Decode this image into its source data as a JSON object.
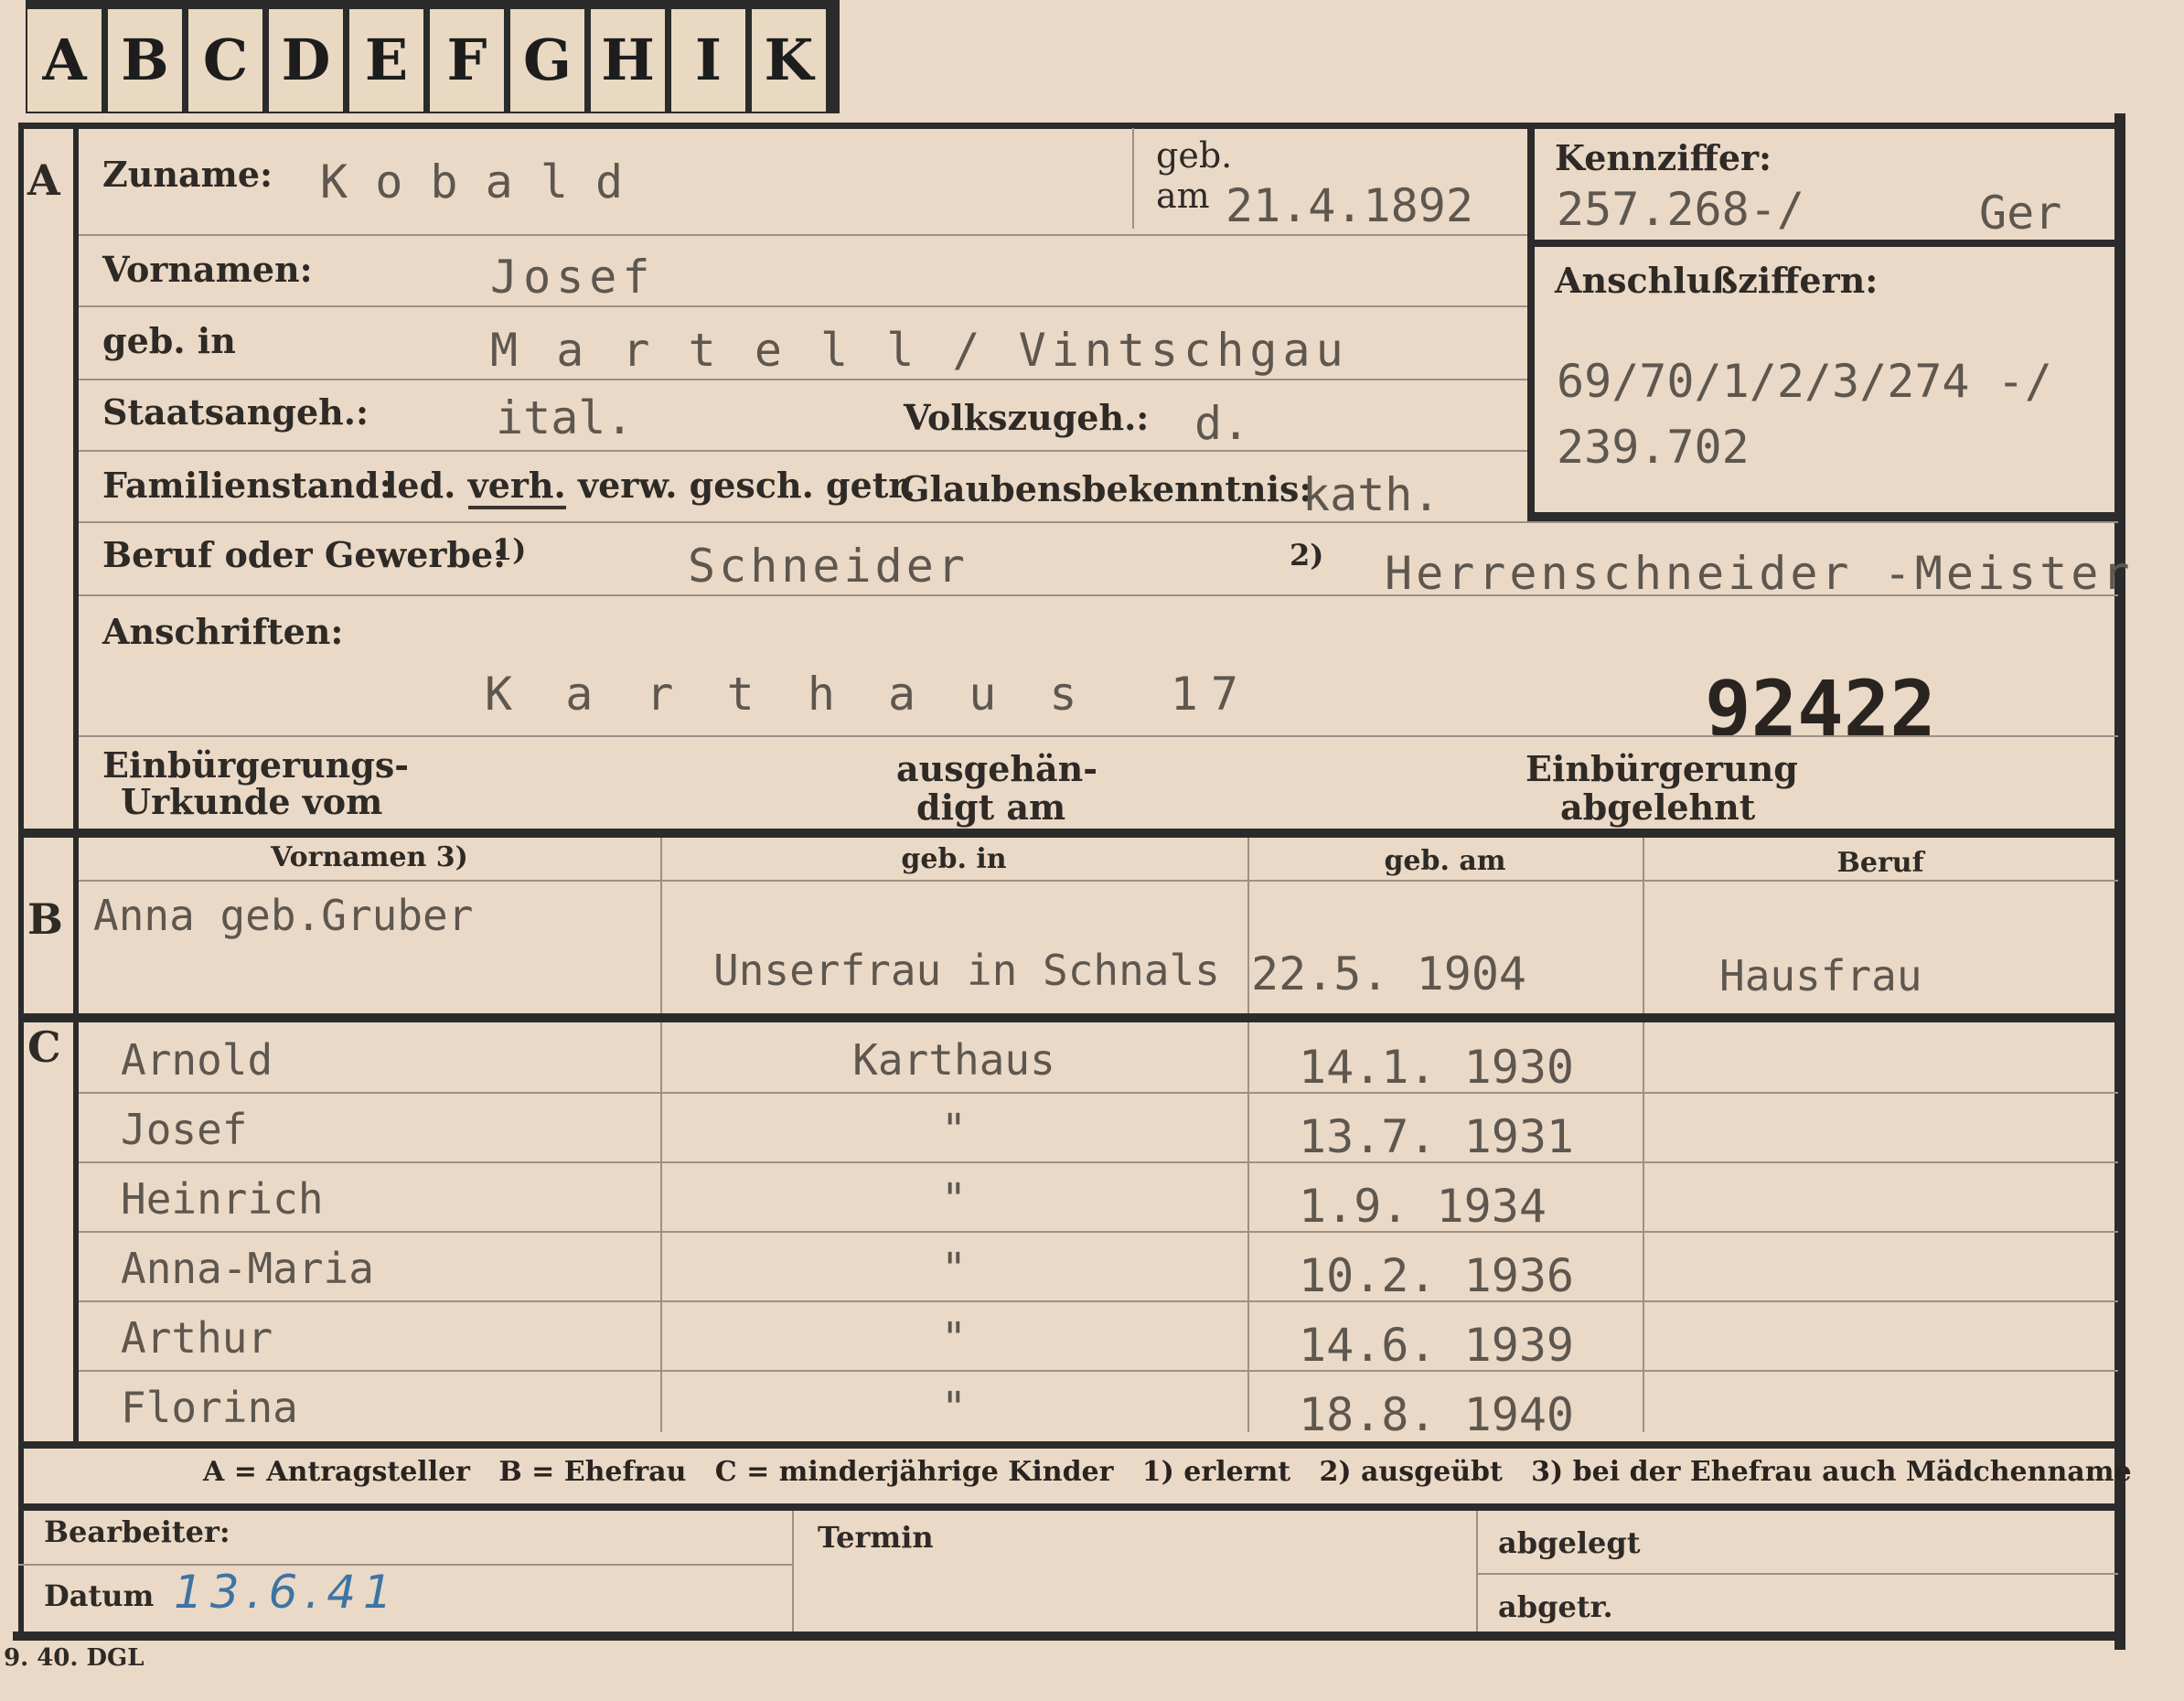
{
  "tabs": [
    "A",
    "B",
    "C",
    "D",
    "E",
    "F",
    "G",
    "H",
    "I",
    "K"
  ],
  "sections": {
    "a": "A",
    "b": "B",
    "c": "C"
  },
  "applicant": {
    "surname_label": "Zuname:",
    "surname": "K o b a l d",
    "born_label": "geb.",
    "born_on_label": "am",
    "born_date": "21.4.1892",
    "id_label": "Kennziffer:",
    "id_number": "257.268-/",
    "id_suffix": "Ger",
    "connect_label": "Anschlußziffern:",
    "connect_line1": "69/70/1/2/3/274 -/",
    "connect_line2": "239.702",
    "firstname_label": "Vornamen:",
    "firstname": "Josef",
    "birthplace_label": "geb. in",
    "birthplace": "M a r t e l l / Vintschgau",
    "citizenship_label": "Staatsangeh.:",
    "citizenship": "ital.",
    "nationality_label": "Volkszugeh.:",
    "nationality": "d.",
    "marital_label": "Familienstand:",
    "marital_options": [
      "led.",
      "verh.",
      "verw.",
      "gesch.",
      "getr."
    ],
    "marital_selected": "verh.",
    "religion_label": "Glaubensbekenntnis:",
    "religion": "kath.",
    "occupation_label": "Beruf oder Gewerbe:",
    "occ_mark1": "1)",
    "occupation_learned": "Schneider",
    "occ_mark2": "2)",
    "occupation_practiced": "Herrenschneider -Meister",
    "address_label": "Anschriften:",
    "address": "K a r t h a u s  17",
    "stamp_number": "92422",
    "naturalization_label_1": "Einbürgerungs-",
    "naturalization_label_2": "Urkunde vom",
    "issued_label_1": "ausgehän-",
    "issued_label_2": "digt am",
    "refused_label_1": "Einbürgerung",
    "refused_label_2": "abgelehnt"
  },
  "table_headers": {
    "firstnames": "Vornamen 3)",
    "born_in": "geb. in",
    "born_on": "geb. am",
    "occupation": "Beruf"
  },
  "wife": {
    "name": "Anna geb.Gruber",
    "born_in": "Unserfrau in Schnals",
    "born_on": "22.5. 1904",
    "occupation": "Hausfrau"
  },
  "children": [
    {
      "name": "Arnold",
      "born_in": "Karthaus",
      "born_on": "14.1. 1930"
    },
    {
      "name": "Josef",
      "born_in": "\"",
      "born_on": "13.7. 1931"
    },
    {
      "name": "Heinrich",
      "born_in": "\"",
      "born_on": "1.9. 1934"
    },
    {
      "name": "Anna-Maria",
      "born_in": "\"",
      "born_on": "10.2. 1936"
    },
    {
      "name": "Arthur",
      "born_in": "\"",
      "born_on": "14.6. 1939"
    },
    {
      "name": "Florina",
      "born_in": "\"",
      "born_on": "18.8. 1940"
    }
  ],
  "legend": "A = Antragsteller   B = Ehefrau   C = minderjährige Kinder   1) erlernt   2) ausgeübt   3) bei der Ehefrau auch Mädchenname",
  "footer": {
    "processor_label": "Bearbeiter:",
    "date_label": "Datum",
    "date_value": "13.6.41",
    "appointment_label": "Termin",
    "filed_label": "abgelegt",
    "sent_label": "abgetr.",
    "print_mark": "9. 40. DGL"
  }
}
